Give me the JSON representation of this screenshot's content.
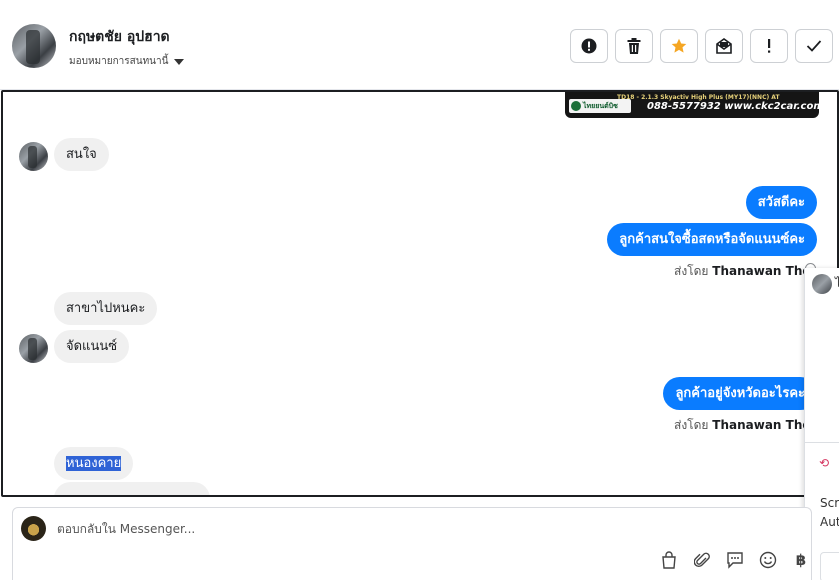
{
  "header": {
    "contact_name": "กฤษตชัย อุปฮาด",
    "assign_label": "มอบหมายการสนทนานี้",
    "actions": [
      {
        "name": "report-icon"
      },
      {
        "name": "trash-icon"
      },
      {
        "name": "star-icon",
        "color": "#f5a623"
      },
      {
        "name": "mark-unread-icon"
      },
      {
        "name": "exclamation-icon"
      },
      {
        "name": "checkmark-icon"
      }
    ]
  },
  "banner": {
    "top_text": "TD18 - 2.1.3 Skyactiv High Plus (MY17)(NNC) AT",
    "logo_text": "ไทยยนต์บิซ",
    "phone": "088-5577932 www.ckc2car.com"
  },
  "messages": {
    "m1": "สนใจ",
    "m2": "สวัสดีคะ",
    "m3": "ลูกค้าสนใจซื้อสดหรือจัดแนนซ์คะ",
    "sent_prefix_1": "ส่งโดย",
    "sent_name_1": "Thanawan Thon",
    "m4": "สาขาไปหนคะ",
    "m5": "จัดแนนซ์",
    "m6": "ลูกค้าอยู่จังหวัดอะไรคะ",
    "sent_prefix_2": "ส่งโดย",
    "sent_name_2": "Thanawan Thon",
    "m7": "หนองคาย"
  },
  "side_panel": {
    "glyph": "ไ",
    "text1": "Scr",
    "text2": "Aut"
  },
  "composer": {
    "placeholder": "ตอบกลับใน Messenger...",
    "tools": [
      {
        "name": "shopping-bag-icon"
      },
      {
        "name": "attachment-icon"
      },
      {
        "name": "saved-reply-icon"
      },
      {
        "name": "emoji-icon"
      },
      {
        "name": "baht-icon"
      }
    ]
  },
  "colors": {
    "outgoing": "#0a7cff",
    "incoming": "#f0f0f0",
    "highlight": "#2f63d6",
    "star": "#f5a623"
  }
}
